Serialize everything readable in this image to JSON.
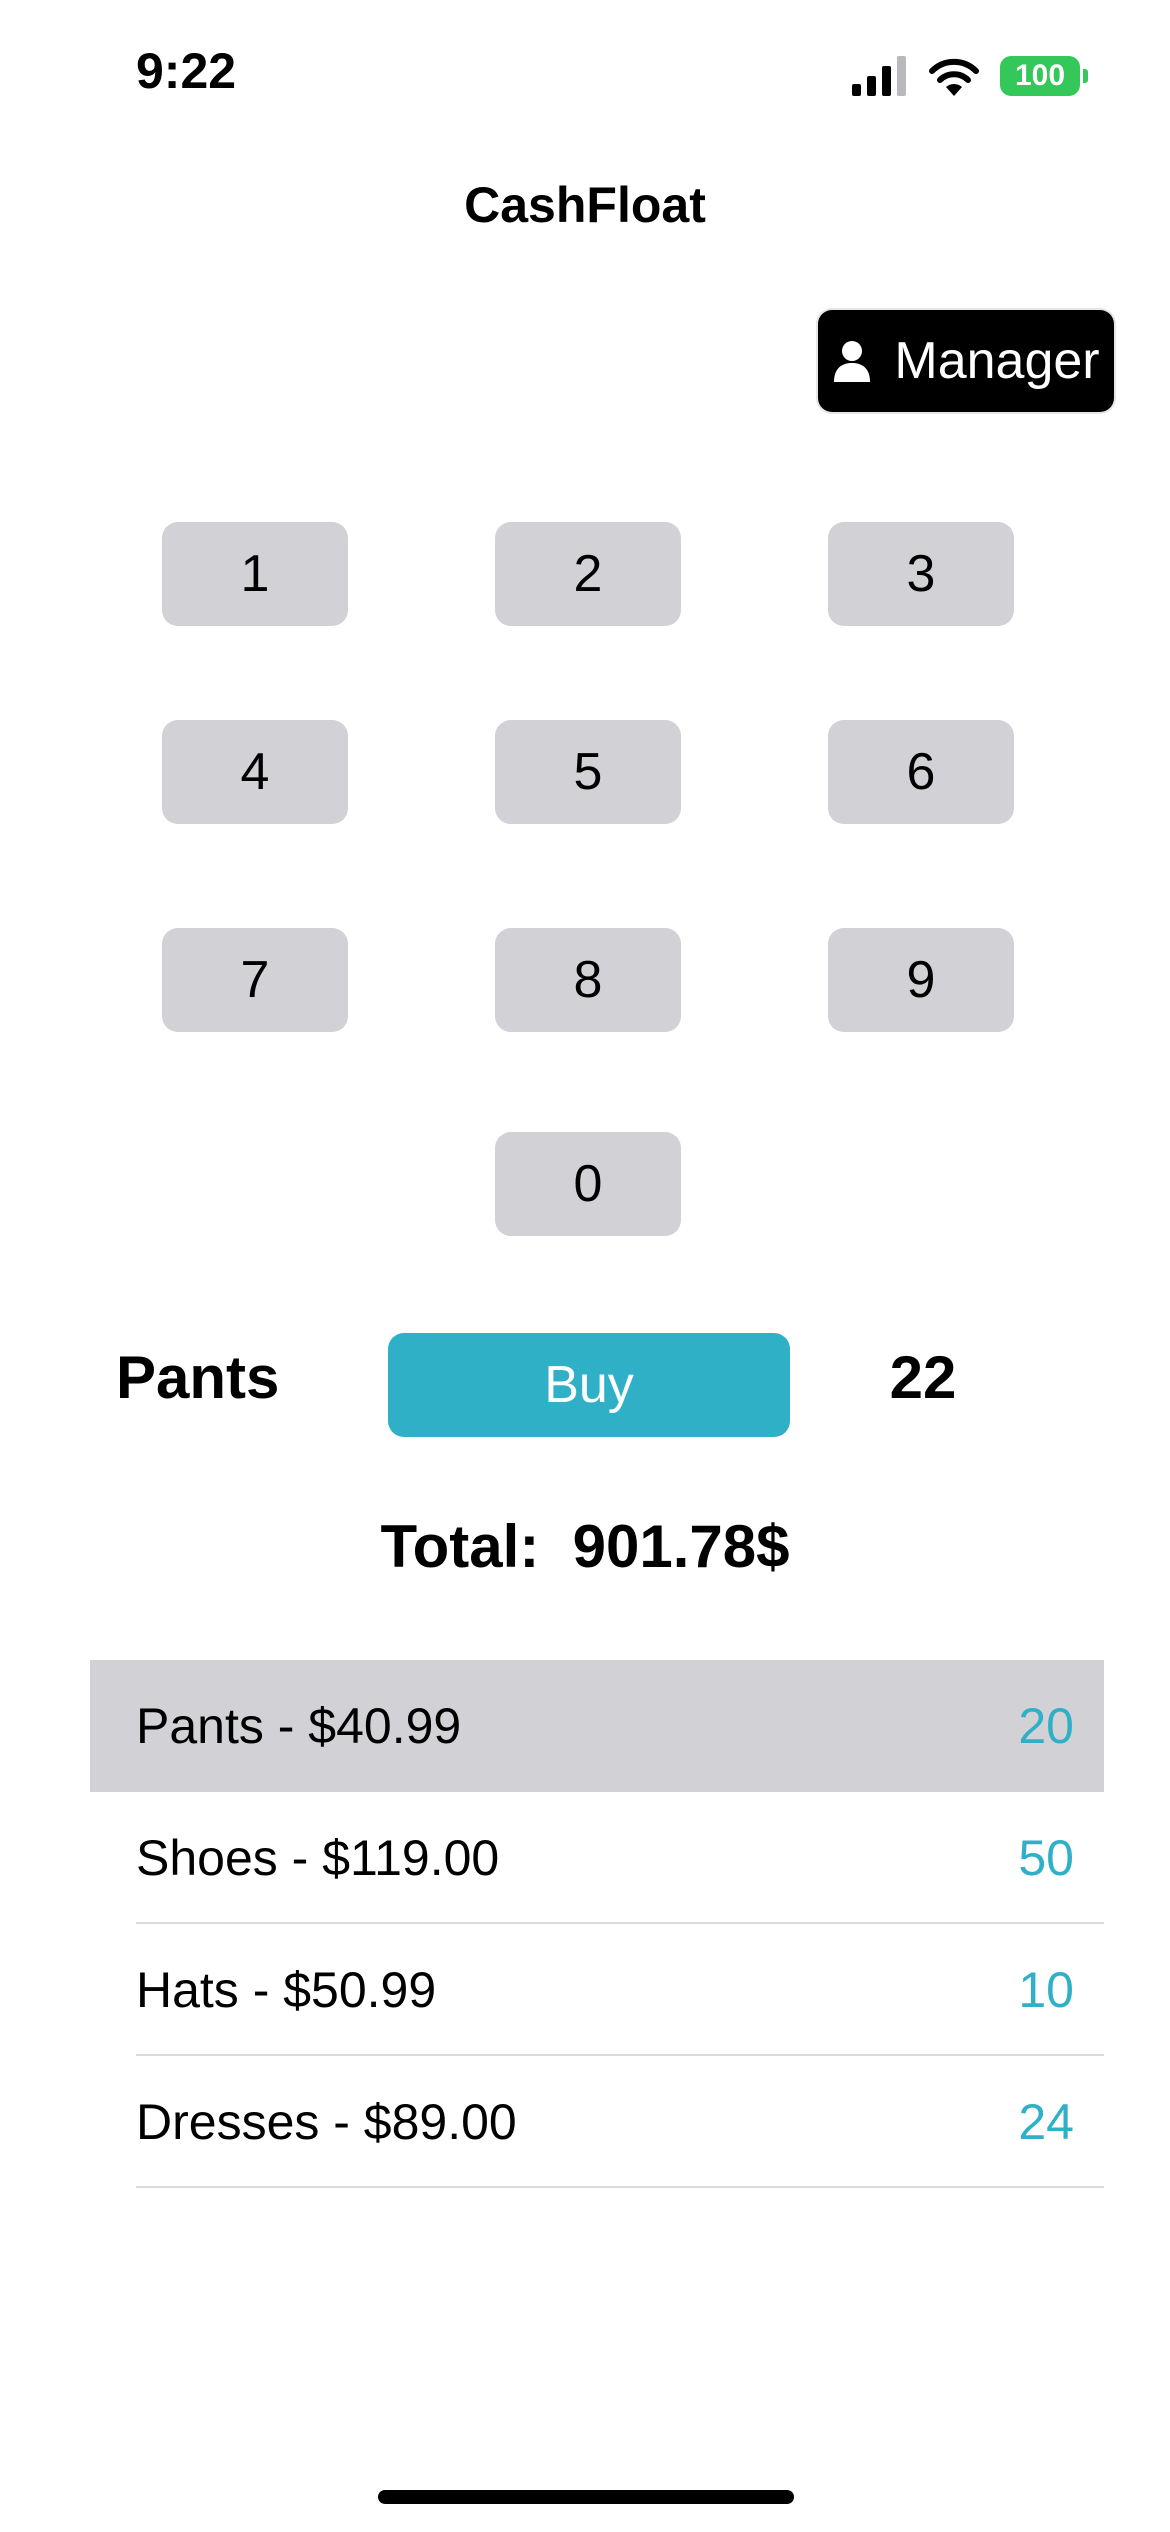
{
  "status_bar": {
    "time": "9:22",
    "battery": "100"
  },
  "nav": {
    "title": "CashFloat"
  },
  "manager_button": {
    "label": "Manager"
  },
  "keypad": {
    "keys": [
      "1",
      "2",
      "3",
      "4",
      "5",
      "6",
      "7",
      "8",
      "9",
      "0"
    ]
  },
  "selection": {
    "product": "Pants",
    "buy_label": "Buy",
    "quantity": "22"
  },
  "total": {
    "label": "Total:",
    "value": "901.78$"
  },
  "products": [
    {
      "label": "Pants - $40.99",
      "count": "20",
      "selected": true
    },
    {
      "label": "Shoes - $119.00",
      "count": "50",
      "selected": false
    },
    {
      "label": "Hats - $50.99",
      "count": "10",
      "selected": false
    },
    {
      "label": "Dresses - $89.00",
      "count": "24",
      "selected": false
    }
  ],
  "colors": {
    "accent": "#30b0c7",
    "key_bg": "#d1d1d6",
    "battery": "#34c759"
  },
  "icons": {
    "signal": "cellular-signal-icon",
    "wifi": "wifi-icon",
    "battery": "battery-icon",
    "manager": "person-icon"
  }
}
